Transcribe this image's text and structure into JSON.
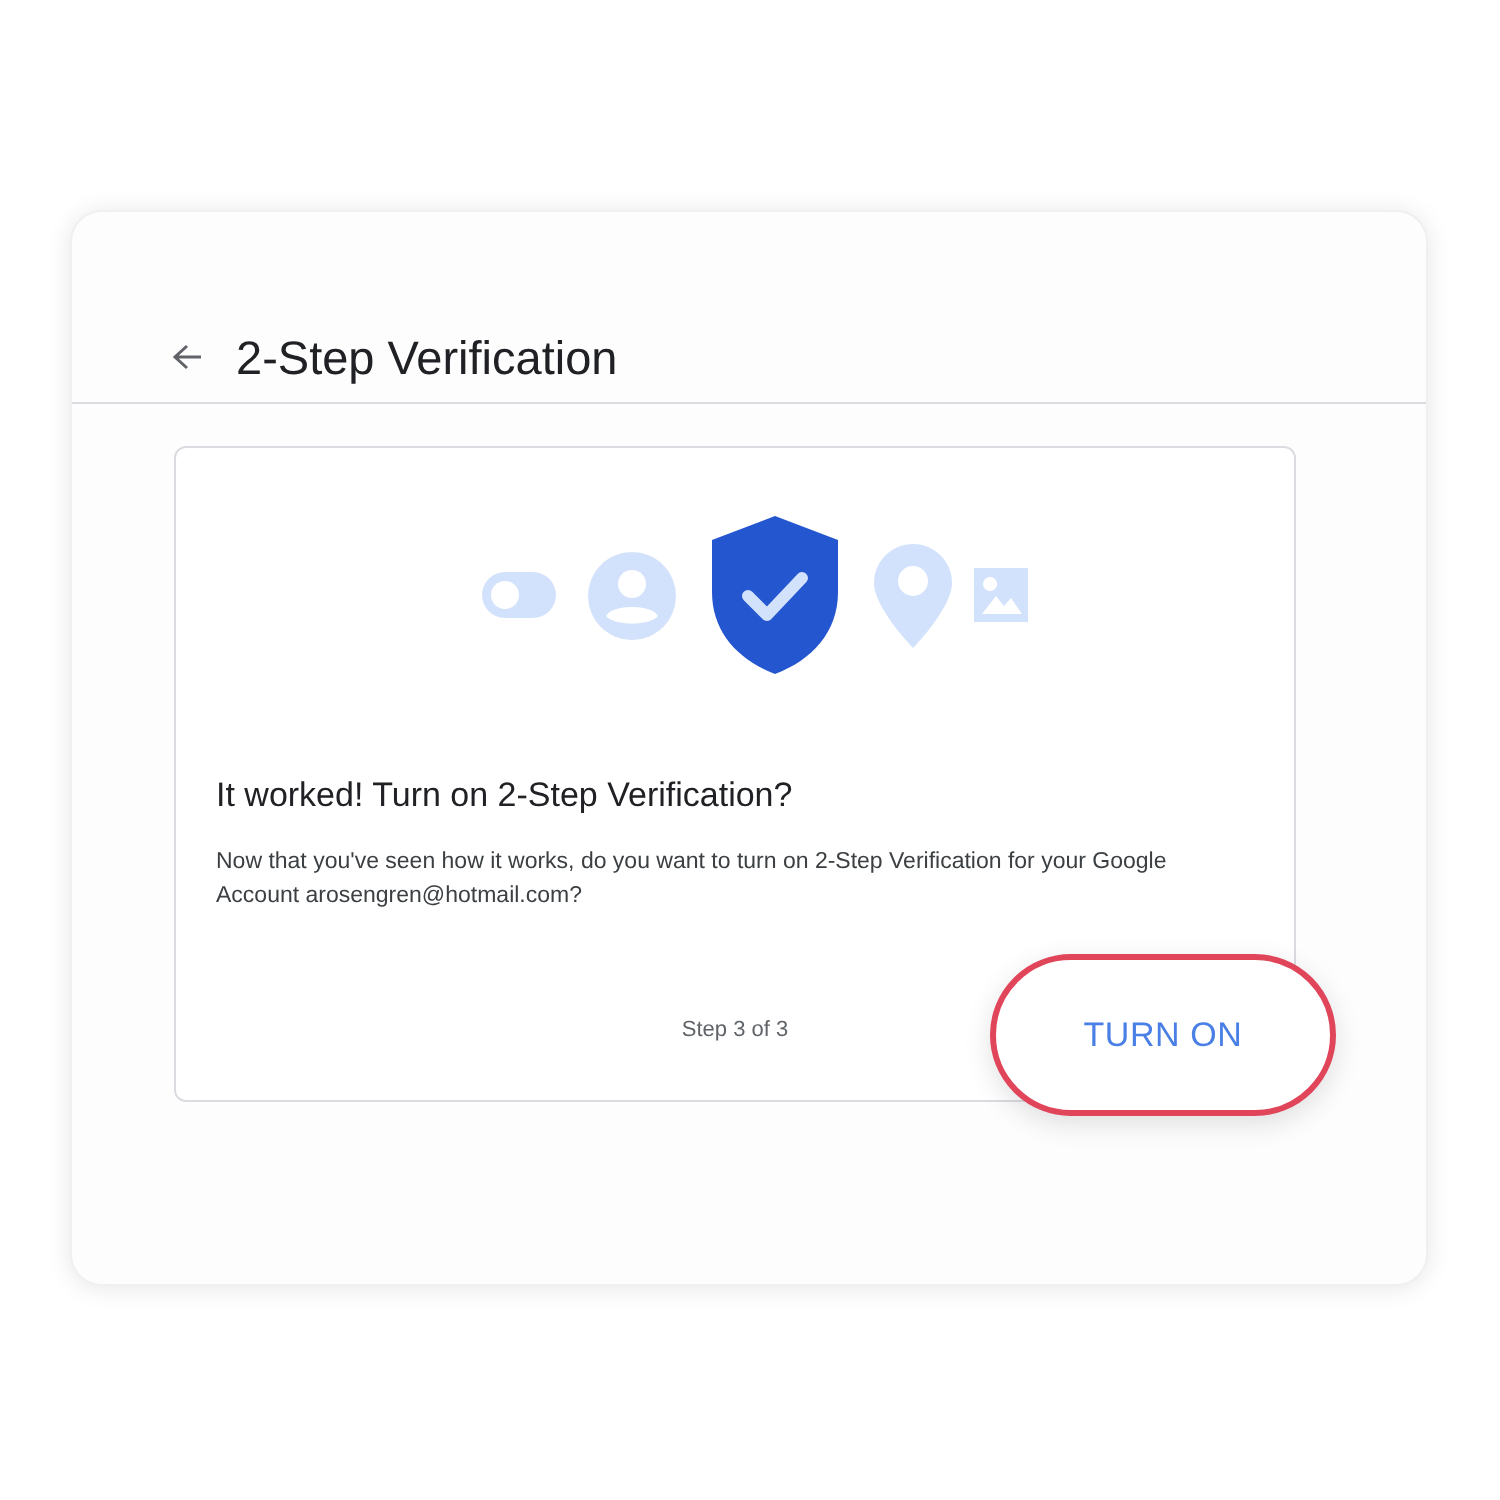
{
  "header": {
    "title": "2-Step Verification"
  },
  "card": {
    "heading": "It worked! Turn on 2-Step Verification?",
    "description": "Now that you've seen how it works, do you want to turn on 2-Step Verification for your Google Account arosengren@hotmail.com?",
    "step": "Step 3 of 3",
    "button": {
      "label": "TURN ON",
      "highlighted": true
    }
  }
}
